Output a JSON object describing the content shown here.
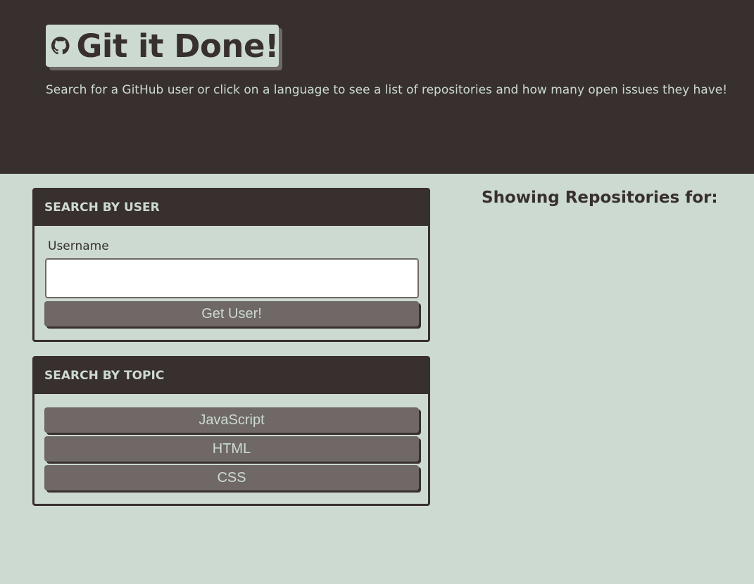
{
  "header": {
    "title": "Git it Done!",
    "subtitle": "Search for a GitHub user or click on a language to see a list of repositories and how many open issues they have!",
    "logo_icon": "github-icon"
  },
  "user_search": {
    "heading": "SEARCH BY USER",
    "label": "Username",
    "input_value": "",
    "button_label": "Get User!"
  },
  "topic_search": {
    "heading": "SEARCH BY TOPIC",
    "buttons": [
      "JavaScript",
      "HTML",
      "CSS"
    ]
  },
  "repos": {
    "heading": "Showing Repositories for:"
  },
  "colors": {
    "dark": "#38302e",
    "light": "#ccdad1",
    "button": "#6f6866"
  }
}
